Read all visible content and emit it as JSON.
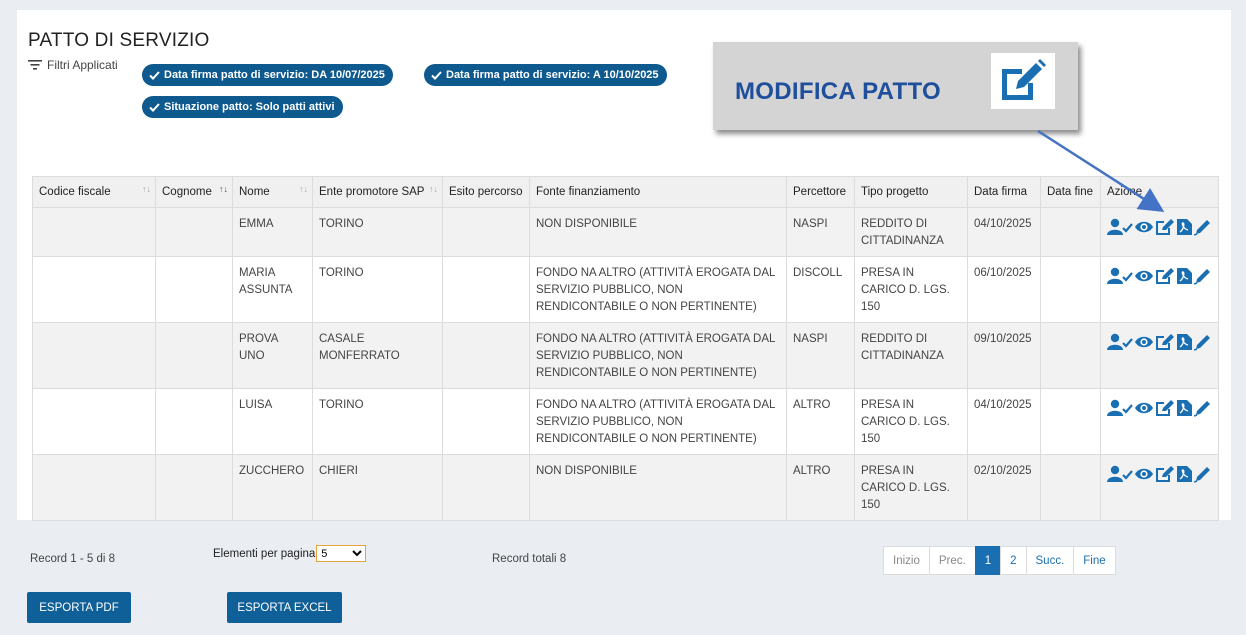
{
  "page": {
    "title": "PATTO DI SERVIZIO",
    "filters_label": "Filtri Applicati",
    "chips": [
      "Data firma patto di servizio: DA 10/07/2025",
      "Data firma patto di servizio: A 10/10/2025",
      "Situazione patto: Solo patti attivi"
    ]
  },
  "callout": {
    "text": "MODIFICA PATTO",
    "icon": "edit-icon"
  },
  "table": {
    "columns": [
      "Codice fiscale",
      "Cognome",
      "Nome",
      "Ente promotore SAP",
      "Esito percorso",
      "Fonte finanziamento",
      "Percettore",
      "Tipo progetto",
      "Data firma",
      "Data fine",
      "Azione"
    ],
    "rows": [
      {
        "codice": "",
        "cognome": "",
        "nome": "EMMA",
        "ente": "TORINO",
        "esito": "",
        "fonte": "NON DISPONIBILE",
        "percettore": "NASPI",
        "tipo": "REDDITO DI CITTADINANZA",
        "data_firma": "04/10/2025",
        "data_fine": ""
      },
      {
        "codice": "",
        "cognome": "",
        "nome": "MARIA ASSUNTA",
        "ente": "TORINO",
        "esito": "",
        "fonte": "FONDO NA ALTRO (ATTIVITÀ EROGATA DAL SERVIZIO PUBBLICO, NON RENDICONTABILE O NON PERTINENTE)",
        "percettore": "DISCOLL",
        "tipo": "PRESA IN CARICO D. LGS. 150",
        "data_firma": "06/10/2025",
        "data_fine": ""
      },
      {
        "codice": "",
        "cognome": "",
        "nome": "PROVA UNO",
        "ente": "CASALE MONFERRATO",
        "esito": "",
        "fonte": "FONDO NA ALTRO (ATTIVITÀ EROGATA DAL SERVIZIO PUBBLICO, NON RENDICONTABILE O NON PERTINENTE)",
        "percettore": "NASPI",
        "tipo": "REDDITO DI CITTADINANZA",
        "data_firma": "09/10/2025",
        "data_fine": ""
      },
      {
        "codice": "",
        "cognome": "",
        "nome": "LUISA",
        "ente": "TORINO",
        "esito": "",
        "fonte": "FONDO NA ALTRO (ATTIVITÀ EROGATA DAL SERVIZIO PUBBLICO, NON RENDICONTABILE O NON PERTINENTE)",
        "percettore": "ALTRO",
        "tipo": "PRESA IN CARICO D. LGS. 150",
        "data_firma": "04/10/2025",
        "data_fine": ""
      },
      {
        "codice": "",
        "cognome": "",
        "nome": "ZUCCHERO",
        "ente": "CHIERI",
        "esito": "",
        "fonte": "NON DISPONIBILE",
        "percettore": "ALTRO",
        "tipo": "PRESA IN CARICO D. LGS. 150",
        "data_firma": "02/10/2025",
        "data_fine": ""
      }
    ],
    "action_icons": [
      "user-check-icon",
      "eye-icon",
      "edit-icon",
      "pdf-icon",
      "pen-icon"
    ]
  },
  "footer": {
    "record_range": "Record 1 - 5 di 8",
    "per_page_label": "Elementi per pagina",
    "per_page_value": "5",
    "total": "Record totali 8",
    "pager": [
      "Inizio",
      "Prec.",
      "1",
      "2",
      "Succ.",
      "Fine"
    ],
    "export_pdf": "ESPORTA PDF",
    "export_excel": "ESPORTA EXCEL"
  },
  "colors": {
    "primary": "#0f5f99",
    "chip": "#0e5a8f",
    "callout_text": "#1f4e9c",
    "arrow": "#4472c4",
    "select_border": "#e8a33a"
  }
}
